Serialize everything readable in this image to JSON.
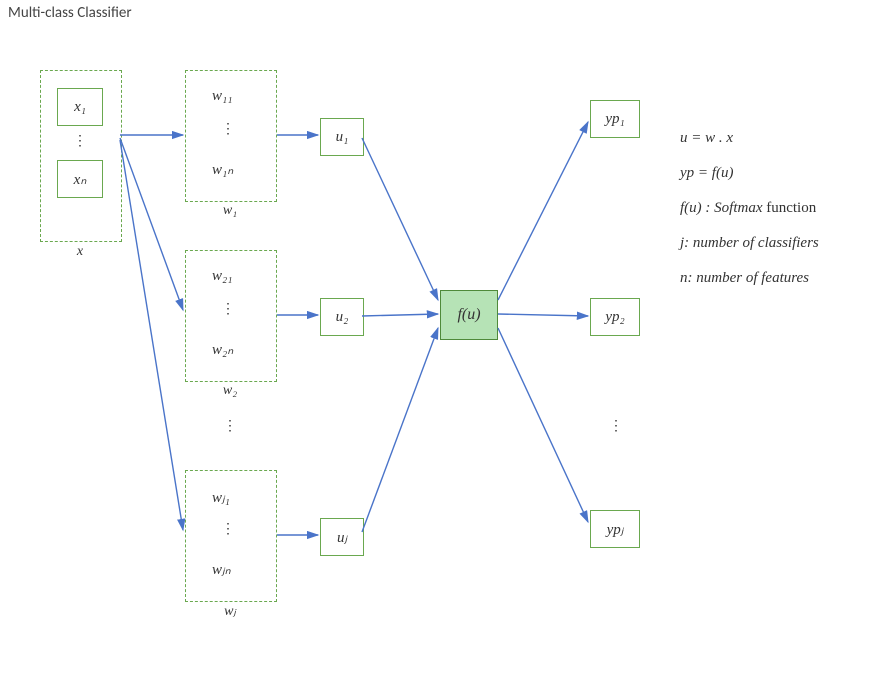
{
  "title": "Multi-class Classifier",
  "input": {
    "label": "x",
    "items": [
      "x₁",
      "xₙ"
    ]
  },
  "weight_blocks": [
    {
      "label": "w₁",
      "entries": [
        "w₁₁",
        "w₁ₙ"
      ],
      "u": "u₁"
    },
    {
      "label": "w₂",
      "entries": [
        "w₂₁",
        "w₂ₙ"
      ],
      "u": "u₂"
    },
    {
      "label": "wⱼ",
      "entries": [
        "wⱼ₁",
        "wⱼₙ"
      ],
      "u": "uⱼ"
    }
  ],
  "activation": "f(u)",
  "outputs": [
    "yp₁",
    "yp₂",
    "ypⱼ"
  ],
  "legend": {
    "eq1": "u = w .  x",
    "eq2": "yp = f(u)",
    "eq3_lhs": "f(u) : ",
    "eq3_mid": "Softmax",
    "eq3_tail": " function",
    "eq4_lhs": "j: ",
    "eq4_rest": "number of classifiers",
    "eq5_lhs": "n: ",
    "eq5_rest": "number of features"
  },
  "dots": "⋮"
}
